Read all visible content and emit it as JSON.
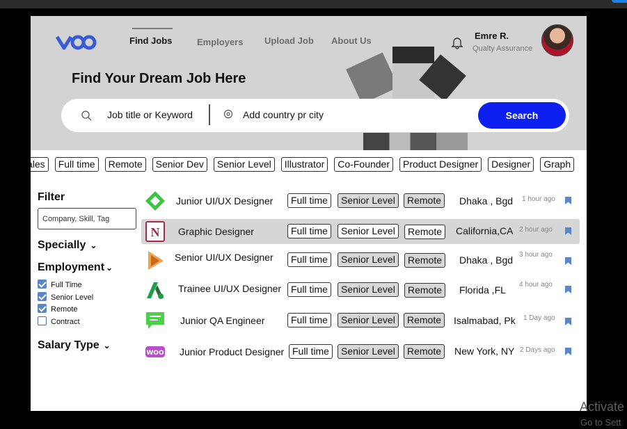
{
  "header": {
    "nav": [
      "Find Jobs",
      "Employers",
      "Upload Job",
      "About Us"
    ],
    "user_name": "Emre R.",
    "user_role": "Qualty Assurance"
  },
  "hero": {
    "headline": "Find Your Dream Job Here",
    "keyword_placeholder": "Job title or Keyword",
    "location_placeholder": "Add country pr city",
    "search_label": "Search"
  },
  "tags": [
    "ales",
    "Full time",
    "Remote",
    "Senior Dev",
    "Senior Level",
    "Illustrator",
    "Co-Founder",
    "Product Designer",
    "Designer",
    "Graph"
  ],
  "sidebar": {
    "filter_title": "Filter",
    "filter_placeholder": "Company, Skill, Tag",
    "specialty_title": "Specially",
    "employment_title": "Employment",
    "employment_options": [
      {
        "label": "Full Time",
        "checked": true
      },
      {
        "label": "Senior Level",
        "checked": true
      },
      {
        "label": "Remote",
        "checked": true
      },
      {
        "label": "Contract",
        "checked": false
      }
    ],
    "salary_title": "Salary Type"
  },
  "jobs": [
    {
      "title": "Junior UI/UX Designer",
      "tags": [
        "Full time",
        "Senior Level",
        "Remote"
      ],
      "location": "Dhaka , Bgd",
      "time": "1 hour ago",
      "logo": "green-diamond-logo-icon"
    },
    {
      "title": "Graphic Designer",
      "tags": [
        "Full time",
        "Senior Level",
        "Remote"
      ],
      "location": "California,CA",
      "time": "2 hour ago",
      "logo": "notion-logo-icon"
    },
    {
      "title": "Senior UI/UX Designer",
      "tags": [
        "Full time",
        "Senior Level",
        "Remote"
      ],
      "location": "Dhaka , Bgd",
      "time": "3 hour ago",
      "logo": "orange-play-logo-icon"
    },
    {
      "title": "Trainee UI/UX Designer",
      "tags": [
        "Full time",
        "Senior Level",
        "Remote"
      ],
      "location": "Florida ,FL",
      "time": "4 hour ago",
      "logo": "green-a-logo-icon"
    },
    {
      "title": "Junior QA Engineer",
      "tags": [
        "Full time",
        "Senior Level",
        "Remote"
      ],
      "location": "Isalmabad, Pk",
      "time": "1 Day ago",
      "logo": "chat-logo-icon"
    },
    {
      "title": "Junior Product Designer",
      "tags": [
        "Full time",
        "Senior Level",
        "Remote"
      ],
      "location": "New York, NY",
      "time": "2 Days ago",
      "logo": "woo-logo-icon"
    }
  ],
  "os": {
    "activate": "Activate",
    "goto": "Go to Sett"
  },
  "colors": {
    "accent": "#0a1ff0",
    "logo_blue": "#3a5bd6",
    "bookmark": "#5a86c8"
  }
}
